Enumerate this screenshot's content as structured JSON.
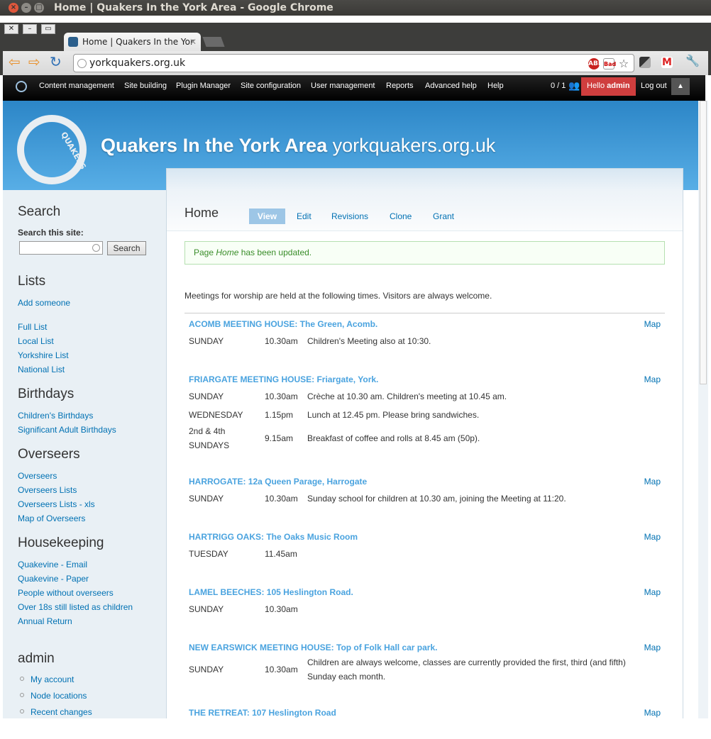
{
  "window": {
    "title": "Home | Quakers In the York Area - Google Chrome"
  },
  "browser": {
    "tab_title": "Home | Quakers In the Yor",
    "url": "yorkquakers.org.uk",
    "ext_abp": "ABP",
    "ext_bad": "Bad"
  },
  "admin_menu": {
    "items": [
      "Content management",
      "Site building",
      "Plugin Manager",
      "Site configuration",
      "User management",
      "Reports",
      "Advanced help",
      "Help"
    ],
    "users_online": "0 / 1",
    "hello": "Hello",
    "user": "admin",
    "logout": "Log out"
  },
  "site": {
    "name": "Quakers In the York Area",
    "slogan": "yorkquakers.org.uk",
    "logo_text": "QUAKERS"
  },
  "sidebar": {
    "search_heading": "Search",
    "search_label": "Search this site:",
    "search_button": "Search",
    "lists_heading": "Lists",
    "lists": [
      "Add someone",
      "Full List",
      "Local List",
      "Yorkshire List",
      "National List"
    ],
    "birthdays_heading": "Birthdays",
    "birthdays": [
      "Children's Birthdays",
      "Significant Adult Birthdays"
    ],
    "overseers_heading": "Overseers",
    "overseers": [
      "Overseers",
      "Overseers Lists",
      "Overseers Lists - xls",
      "Map of Overseers"
    ],
    "housekeeping_heading": "Housekeeping",
    "housekeeping": [
      "Quakevine - Email",
      "Quakevine - Paper",
      "People without overseers",
      "Over 18s still listed as children",
      "Annual Return"
    ],
    "admin_heading": "admin",
    "admin": [
      "My account",
      "Node locations",
      "Recent changes"
    ]
  },
  "page": {
    "title": "Home",
    "tabs": [
      "View",
      "Edit",
      "Revisions",
      "Clone",
      "Grant"
    ],
    "status_pre": "Page ",
    "status_em": "Home",
    "status_post": " has been updated.",
    "intro": "Meetings for worship are held at the following times. Visitors are always welcome.",
    "map_label": "Map",
    "meetings": [
      {
        "name": "ACOMB MEETING HOUSE: The Green, Acomb.",
        "rows": [
          {
            "day": "SUNDAY",
            "time": "10.30am",
            "note": "Children's Meeting also at 10:30."
          }
        ]
      },
      {
        "name": "FRIARGATE MEETING HOUSE: Friargate, York.",
        "rows": [
          {
            "day": "SUNDAY",
            "time": "10.30am",
            "note": "Crèche at 10.30 am. Children's meeting at 10.45 am."
          },
          {
            "day": "WEDNESDAY",
            "time": "1.15pm",
            "note": "Lunch at 12.45 pm. Please bring sandwiches."
          },
          {
            "day": "2nd & 4th SUNDAYS",
            "time": "9.15am",
            "note": "Breakfast of coffee and rolls at 8.45 am (50p)."
          }
        ]
      },
      {
        "name": "HARROGATE: 12a Queen Parage, Harrogate",
        "rows": [
          {
            "day": "SUNDAY",
            "time": "10.30am",
            "note": "Sunday school for children at 10.30 am, joining the Meeting at 11:20."
          }
        ]
      },
      {
        "name": "HARTRIGG OAKS: The Oaks Music Room",
        "rows": [
          {
            "day": "TUESDAY",
            "time": "11.45am",
            "note": ""
          }
        ]
      },
      {
        "name": "LAMEL BEECHES: 105 Heslington Road.",
        "rows": [
          {
            "day": "SUNDAY",
            "time": "10.30am",
            "note": ""
          }
        ]
      },
      {
        "name": "NEW EARSWICK MEETING HOUSE: Top of Folk Hall car park.",
        "rows": [
          {
            "day": "SUNDAY",
            "time": "10.30am",
            "note": "Children are always welcome, classes are currently provided the first, third (and fifth) Sunday each month."
          }
        ]
      },
      {
        "name": "THE RETREAT: 107 Heslington Road",
        "rows": []
      }
    ]
  }
}
